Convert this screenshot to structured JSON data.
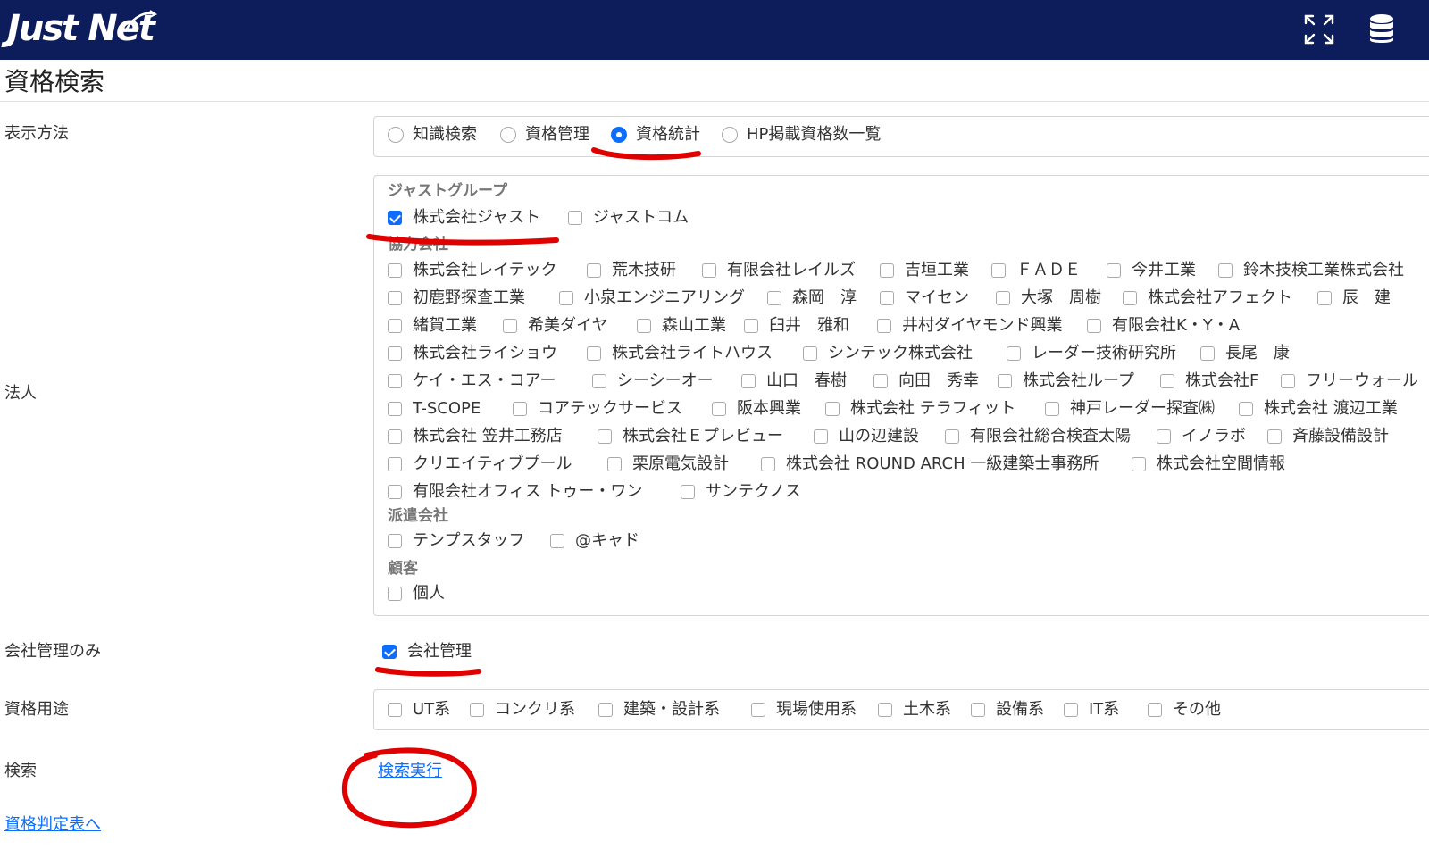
{
  "header": {
    "logo_text": "Just Net",
    "expand_icon": "expand-icon",
    "db_icon": "database-icon",
    "bg_color": "#0d1d5c"
  },
  "page": {
    "title": "資格検索"
  },
  "display_method": {
    "label": "表示方法",
    "options": [
      "知識検索",
      "資格管理",
      "資格統計",
      "HP掲載資格数一覧"
    ],
    "selected": "資格統計"
  },
  "corporation": {
    "label": "法人",
    "groups": {
      "just": {
        "title": "ジャストグループ",
        "items": [
          "株式会社ジャスト",
          "ジャストコム"
        ],
        "checked": [
          "株式会社ジャスト"
        ]
      },
      "partners": {
        "title": "協力会社",
        "rows": [
          [
            "株式会社レイテック",
            "荒木技研",
            "有限会社レイルズ",
            "吉垣工業",
            "ＦＡＤＥ",
            "今井工業",
            "鈴木技検工業株式会社"
          ],
          [
            "初鹿野探査工業",
            "小泉エンジニアリング",
            "森岡　淳",
            "マイセン",
            "大塚　周樹",
            "株式会社アフェクト",
            "辰　建"
          ],
          [
            "緒賀工業",
            "希美ダイヤ",
            "森山工業",
            "臼井　雅和",
            "井村ダイヤモンド興業",
            "有限会社K・Y・A"
          ],
          [
            "株式会社ライショウ",
            "株式会社ライトハウス",
            "シンテック株式会社",
            "レーダー技術研究所",
            "長尾　康"
          ],
          [
            "ケイ・エス・コアー",
            "シーシーオー",
            "山口　春樹",
            "向田　秀幸",
            "株式会社ループ",
            "株式会社F",
            "フリーウォール"
          ],
          [
            "T-SCOPE",
            "コアテックサービス",
            "阪本興業",
            "株式会社 テラフィット",
            "神戸レーダー探査㈱",
            "株式会社 渡辺工業"
          ],
          [
            "株式会社 笠井工務店",
            "株式会社Ｅプレビュー",
            "山の辺建設",
            "有限会社総合検査太陽",
            "イノラボ",
            "斉藤設備設計"
          ],
          [
            "クリエイティブプール",
            "栗原電気設計",
            "株式会社 ROUND ARCH 一級建築士事務所",
            "株式会社空間情報"
          ],
          [
            "有限会社オフィス トゥー・ワン",
            "サンテクノス"
          ]
        ]
      },
      "dispatch": {
        "title": "派遣会社",
        "items": [
          "テンプスタッフ",
          "@キャド"
        ]
      },
      "customer": {
        "title": "顧客",
        "items": [
          "個人"
        ]
      }
    }
  },
  "company_only": {
    "label": "会社管理のみ",
    "option": "会社管理",
    "checked": true
  },
  "usage": {
    "label": "資格用途",
    "options": [
      "UT系",
      "コンクリ系",
      "建築・設計系",
      "現場使用系",
      "土木系",
      "設備系",
      "IT系",
      "その他"
    ]
  },
  "search": {
    "label": "検索",
    "link": "検索実行"
  },
  "footer_link": "資格判定表へ",
  "colors": {
    "accent": "#0d6efd",
    "annotation": "#e00000"
  }
}
